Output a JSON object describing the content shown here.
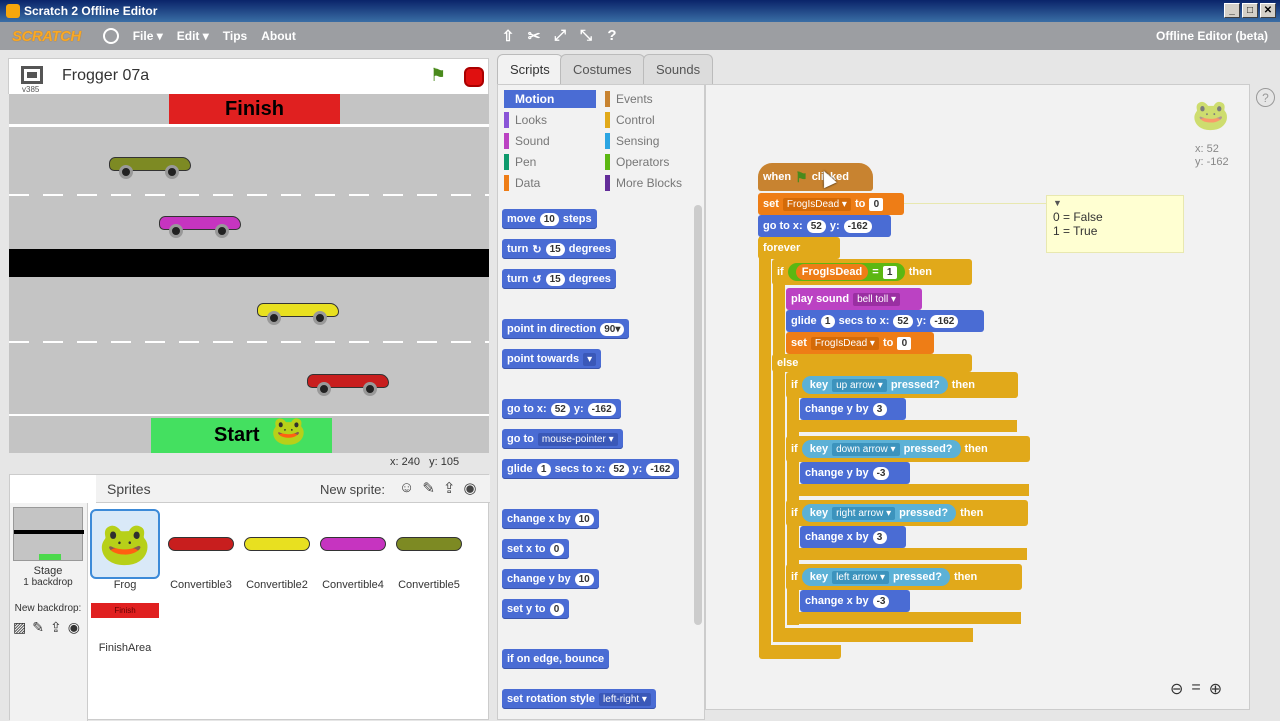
{
  "window": {
    "title": "Scratch 2 Offline Editor",
    "buttons": [
      "_",
      "□",
      "✕"
    ]
  },
  "menu": {
    "logo": "SCRATCH",
    "items": [
      "File ▾",
      "Edit ▾",
      "Tips",
      "About"
    ],
    "mode": "Offline Editor (beta)"
  },
  "project": {
    "title": "Frogger 07a",
    "version": "v385"
  },
  "stage_coords": {
    "x_label": "x:",
    "x": "240",
    "y_label": "y:",
    "y": "105"
  },
  "stage": {
    "finish": "Finish",
    "start": "Start"
  },
  "sprites": {
    "header": "Sprites",
    "new_sprite": "New sprite:",
    "stage_label": "Stage",
    "backdrops": "1 backdrop",
    "new_backdrop": "New backdrop:",
    "list": [
      "Frog",
      "Convertible3",
      "Convertible2",
      "Convertible4",
      "Convertible5"
    ],
    "finish_thumb": "Finish",
    "finish_area": "FinishArea"
  },
  "tabs": [
    "Scripts",
    "Costumes",
    "Sounds"
  ],
  "categories": [
    {
      "label": "Motion",
      "color": "#4a6cd4"
    },
    {
      "label": "Events",
      "color": "#c88330"
    },
    {
      "label": "Looks",
      "color": "#8a55d7"
    },
    {
      "label": "Control",
      "color": "#e1a91a"
    },
    {
      "label": "Sound",
      "color": "#bb42c3"
    },
    {
      "label": "Sensing",
      "color": "#2ca5e2"
    },
    {
      "label": "Pen",
      "color": "#0e9a6c"
    },
    {
      "label": "Operators",
      "color": "#5cb712"
    },
    {
      "label": "Data",
      "color": "#ee7d16"
    },
    {
      "label": "More Blocks",
      "color": "#632d99"
    }
  ],
  "palette": {
    "move": "move",
    "move_n": "10",
    "steps": "steps",
    "turn": "turn",
    "turn_n": "15",
    "degrees": "degrees",
    "point_dir": "point in direction",
    "point_dir_n": "90▾",
    "point_towards": "point towards",
    "goto": "go to x:",
    "goto_x": "52",
    "goto_y_l": "y:",
    "goto_y": "-162",
    "goto2": "go to",
    "goto2_d": "mouse-pointer ▾",
    "glide": "glide",
    "glide_n": "1",
    "glide_m": "secs to x:",
    "glide_x": "52",
    "glide_yl": "y:",
    "glide_y": "-162",
    "chx": "change x by",
    "chx_n": "10",
    "setx": "set x to",
    "setx_n": "0",
    "chy": "change y by",
    "chy_n": "10",
    "sety": "set y to",
    "sety_n": "0",
    "bounce": "if on edge, bounce",
    "rot": "set rotation style",
    "rot_d": "left-right ▾"
  },
  "script": {
    "when": "when",
    "clicked": "clicked",
    "set": "set",
    "var": "FrogIsDead ▾",
    "to": "to",
    "zero": "0",
    "goto": "go to x:",
    "gx": "52",
    "gyl": "y:",
    "gy": "-162",
    "forever": "forever",
    "if": "if",
    "then": "then",
    "eq_var": "FrogIsDead",
    "eq": "=",
    "one": "1",
    "play": "play sound",
    "sound": "bell toll ▾",
    "glide": "glide",
    "gn": "1",
    "gm": "secs to x:",
    "else": "else",
    "key": "key",
    "pressed": "pressed?",
    "up": "up arrow ▾",
    "down": "down arrow ▾",
    "right": "right arrow ▾",
    "left": "left arrow ▾",
    "chy": "change y by",
    "chx": "change x by",
    "three": "3",
    "neg3": "-3"
  },
  "comment": {
    "line1": "0 = False",
    "line2": "1 = True"
  },
  "sprite_info": {
    "x": "x: 52",
    "y": "y: -162"
  }
}
